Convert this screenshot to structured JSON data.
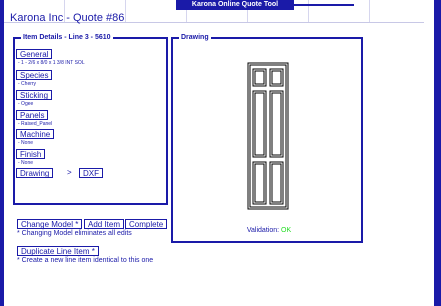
{
  "app": {
    "title": "Karona Online Quote Tool"
  },
  "quote": {
    "title": "Karona Inc - Quote #86"
  },
  "item_details": {
    "legend": "Item Details - Line 3 - 5610",
    "fields": [
      {
        "label": "General",
        "value": "- 1 - 2/6 x 8/0 x 1 3/8 INT SOL"
      },
      {
        "label": "Species",
        "value": "- Cherry"
      },
      {
        "label": "Sticking",
        "value": "- Ogee"
      },
      {
        "label": "Panels",
        "value": "- Raised_Panel"
      },
      {
        "label": "Machine",
        "value": "- None"
      },
      {
        "label": "Finish",
        "value": "- None"
      }
    ],
    "drawing_label": "Drawing",
    "drawing_separator": ">",
    "dxf_label": "DXF"
  },
  "drawing": {
    "legend": "Drawing",
    "validation_label": "Validation:",
    "validation_status": "OK",
    "validation_color": "#22dd22"
  },
  "actions": {
    "change_model": "Change Model *",
    "add_item": "Add Item",
    "complete": "Complete",
    "change_model_note": "* Changing Model eliminates all edits",
    "duplicate_line_item": "Duplicate Line Item *",
    "duplicate_note": "* Create a new line item identical to this one"
  },
  "colors": {
    "brand": "#1a1aa8",
    "ok": "#22dd22"
  }
}
